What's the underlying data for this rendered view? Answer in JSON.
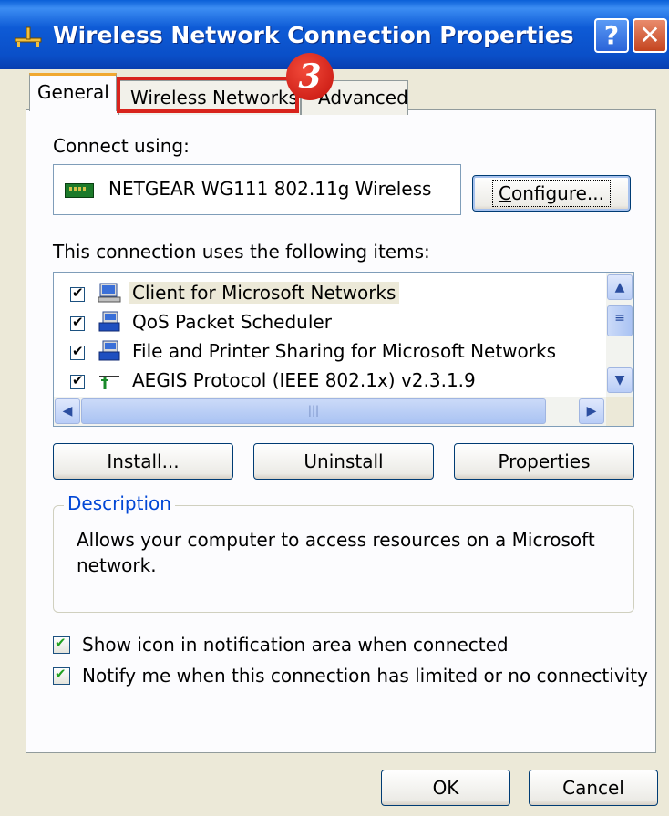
{
  "window": {
    "title": "Wireless Network Connection Properties"
  },
  "titlebar": {
    "help_label": "?",
    "close_label": "✕"
  },
  "tabs": [
    {
      "label": "General"
    },
    {
      "label": "Wireless Networks"
    },
    {
      "label": "Advanced"
    }
  ],
  "step_badge": "3",
  "general": {
    "connect_using_label": "Connect using:",
    "adapter_name": "NETGEAR WG111 802.11g Wireless",
    "configure": {
      "label": "Configure...",
      "accel": "C",
      "rest": "onfigure..."
    },
    "items_label": "This connection uses the following items:",
    "items": [
      {
        "label": "Client for Microsoft Networks",
        "checked": true,
        "icon": "network-client-icon"
      },
      {
        "label": "QoS Packet Scheduler",
        "checked": true,
        "icon": "network-service-icon"
      },
      {
        "label": "File and Printer Sharing for Microsoft Networks",
        "checked": true,
        "icon": "network-service-icon"
      },
      {
        "label": "AEGIS Protocol (IEEE 802.1x) v2.3.1.9",
        "checked": true,
        "icon": "protocol-icon"
      }
    ],
    "install": {
      "pre": "",
      "accel": "",
      "post": "Install...",
      "label": "Install..."
    },
    "uninstall": {
      "label": "Uninstall"
    },
    "properties": {
      "label": "Properties"
    },
    "description": {
      "title": "Description",
      "text": "Allows your computer to access resources on a Microsoft network."
    },
    "show_icon": {
      "label": "Show icon in notification area when connected",
      "checked": true
    },
    "notify": {
      "label": "Notify me when this connection has limited or no connectivity",
      "checked": true
    }
  },
  "footer": {
    "ok": "OK",
    "cancel": "Cancel"
  }
}
